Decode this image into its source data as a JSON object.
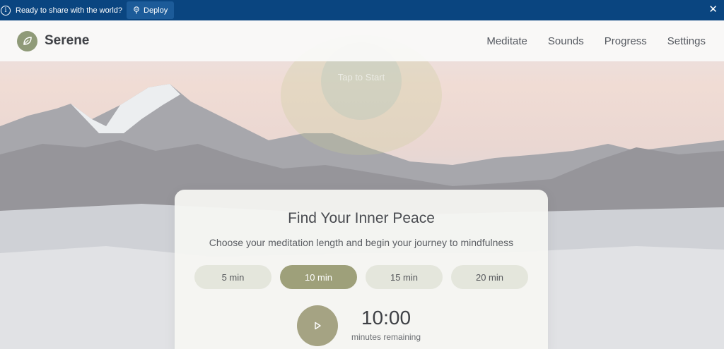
{
  "banner": {
    "message": "Ready to share with the world?",
    "deploy_label": "Deploy"
  },
  "app": {
    "brand": "Serene"
  },
  "nav": {
    "items": [
      "Meditate",
      "Sounds",
      "Progress",
      "Settings"
    ]
  },
  "orb": {
    "label": "Tap to Start"
  },
  "card": {
    "title": "Find Your Inner Peace",
    "subtitle": "Choose your meditation length and begin your journey to mindfulness",
    "durations": [
      "5 min",
      "10 min",
      "15 min",
      "20 min"
    ],
    "selected_duration": "10 min",
    "timer": "10:00",
    "timer_label": "minutes remaining"
  },
  "colors": {
    "banner": "#0a4580",
    "accent": "#9ea07a",
    "brand": "#8f9a78"
  }
}
